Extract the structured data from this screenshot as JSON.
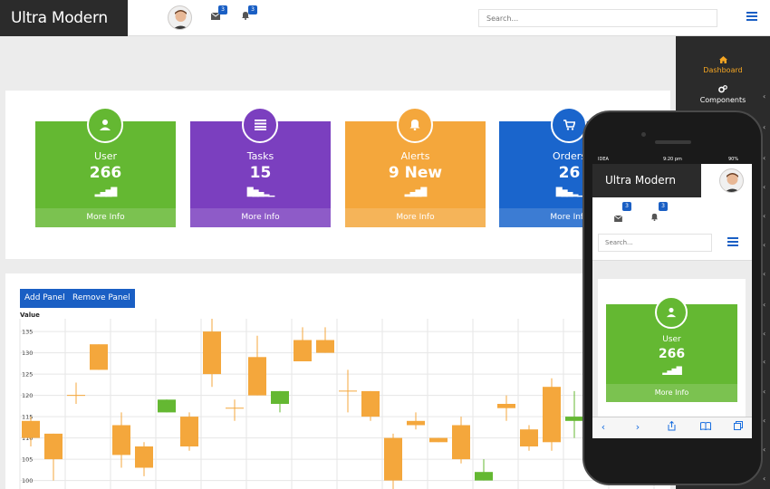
{
  "app": {
    "brand": "Ultra Modern"
  },
  "header": {
    "mail_badge": "3",
    "bell_badge": "3",
    "search_placeholder": "Search..."
  },
  "sidebar": {
    "items": [
      {
        "label": "Dashboard",
        "icon": "home-icon",
        "active": true
      },
      {
        "label": "Components",
        "icon": "cogs-icon",
        "active": false
      }
    ],
    "accent": "#f5a623"
  },
  "cards": [
    {
      "title": "User",
      "value": "266",
      "footer": "More Info",
      "icon": "user-icon",
      "color": "#64b832"
    },
    {
      "title": "Tasks",
      "value": "15",
      "footer": "More Info",
      "icon": "list-icon",
      "color": "#7b3fbf"
    },
    {
      "title": "Alerts",
      "value": "9 New",
      "footer": "More Info",
      "icon": "bell-icon",
      "color": "#f4a73c"
    },
    {
      "title": "Orders",
      "value": "26",
      "footer": "More Info",
      "icon": "cart-icon",
      "color": "#1a65cc"
    }
  ],
  "chart_panel": {
    "add_label": "Add Panel",
    "remove_label": "Remove Panel"
  },
  "chart_data": {
    "type": "candlestick",
    "ylabel": "Value",
    "ylim": [
      98,
      138
    ],
    "yticks": [
      100,
      105,
      110,
      115,
      120,
      125,
      130,
      135
    ],
    "colors": {
      "down": "#f4a73c",
      "up": "#64b832",
      "grid": "#e6e6e6"
    },
    "candles": [
      {
        "open": 114,
        "close": 110,
        "high": 115,
        "low": 108
      },
      {
        "open": 111,
        "close": 105,
        "high": 111,
        "low": 100
      },
      {
        "open": 120,
        "close": 120,
        "high": 123,
        "low": 118
      },
      {
        "open": 132,
        "close": 126,
        "high": 132,
        "low": 126
      },
      {
        "open": 113,
        "close": 106,
        "high": 116,
        "low": 103
      },
      {
        "open": 108,
        "close": 103,
        "high": 109,
        "low": 101
      },
      {
        "open": 116,
        "close": 119,
        "high": 119,
        "low": 116
      },
      {
        "open": 115,
        "close": 108,
        "high": 116,
        "low": 107
      },
      {
        "open": 135,
        "close": 125,
        "high": 138,
        "low": 122
      },
      {
        "open": 117,
        "close": 117,
        "high": 119,
        "low": 114
      },
      {
        "open": 129,
        "close": 120,
        "high": 134,
        "low": 120
      },
      {
        "open": 118,
        "close": 121,
        "high": 121,
        "low": 116
      },
      {
        "open": 133,
        "close": 128,
        "high": 136,
        "low": 128
      },
      {
        "open": 133,
        "close": 130,
        "high": 136,
        "low": 130
      },
      {
        "open": 121,
        "close": 121,
        "high": 126,
        "low": 116
      },
      {
        "open": 121,
        "close": 115,
        "high": 121,
        "low": 114
      },
      {
        "open": 110,
        "close": 100,
        "high": 111,
        "low": 98
      },
      {
        "open": 114,
        "close": 113,
        "high": 116,
        "low": 112
      },
      {
        "open": 110,
        "close": 109,
        "high": 110,
        "low": 109
      },
      {
        "open": 113,
        "close": 105,
        "high": 115,
        "low": 104
      },
      {
        "open": 100,
        "close": 102,
        "high": 105,
        "low": 100
      },
      {
        "open": 118,
        "close": 117,
        "high": 120,
        "low": 114
      },
      {
        "open": 112,
        "close": 108,
        "high": 113,
        "low": 107
      },
      {
        "open": 122,
        "close": 109,
        "high": 124,
        "low": 107
      },
      {
        "open": 114,
        "close": 115,
        "high": 121,
        "low": 110
      }
    ]
  },
  "phone": {
    "carrier": "IDEA",
    "time": "9:20 pm",
    "battery": "90%",
    "brand": "Ultra Modern",
    "mail_badge": "3",
    "bell_badge": "3",
    "search_placeholder": "Search...",
    "card": {
      "title": "User",
      "value": "266",
      "footer": "More Info"
    }
  }
}
